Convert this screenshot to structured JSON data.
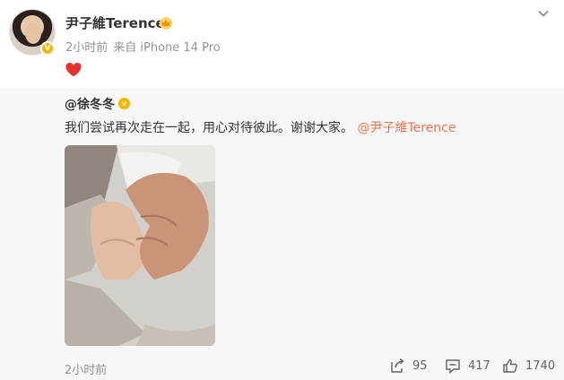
{
  "post": {
    "username": "尹子維Terence",
    "time": "2小时前",
    "source": "来自 iPhone 14 Pro",
    "icons": {
      "avatar": "avatar",
      "verified": "verified-badge",
      "user_badge": "member-crown-badge",
      "more": "chevron-down-icon",
      "heart": "red-heart-emoji"
    }
  },
  "repost": {
    "original_user": "@徐冬冬",
    "original_text": "我们尝试再次走在一起，用心对待彼此。谢谢大家。",
    "mention": "@尹子維Terence",
    "time": "2小时前",
    "actions": {
      "share_count": "95",
      "comment_count": "417",
      "like_count": "1740"
    }
  },
  "colors": {
    "mention": "#eb7350",
    "muted": "#939393",
    "repost_bg": "#f7f7f7",
    "verified": "#f7b500",
    "heart": "#e8312f"
  }
}
